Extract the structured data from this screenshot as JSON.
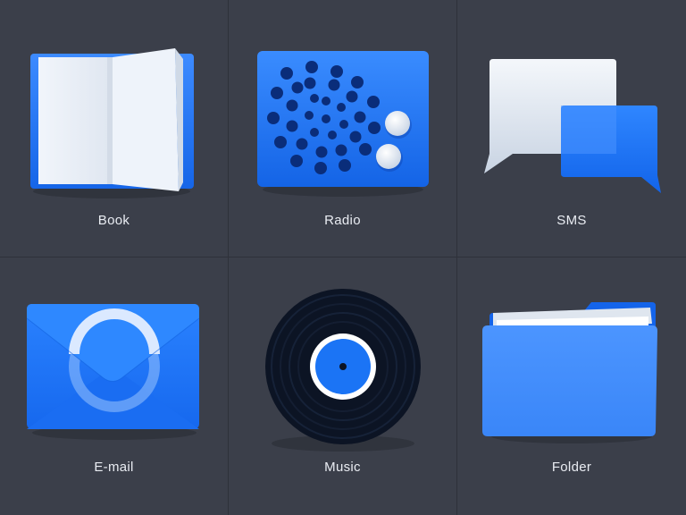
{
  "icons": [
    {
      "id": "book",
      "label": "Book",
      "icon": "book-icon"
    },
    {
      "id": "radio",
      "label": "Radio",
      "icon": "radio-icon"
    },
    {
      "id": "sms",
      "label": "SMS",
      "icon": "sms-icon"
    },
    {
      "id": "email",
      "label": "E-mail",
      "icon": "mail-icon"
    },
    {
      "id": "music",
      "label": "Music",
      "icon": "vinyl-icon"
    },
    {
      "id": "folder",
      "label": "Folder",
      "icon": "folder-icon"
    }
  ],
  "colors": {
    "background": "#3b3f4a",
    "accent": "#1a73f5",
    "label": "#e9ecf2"
  }
}
